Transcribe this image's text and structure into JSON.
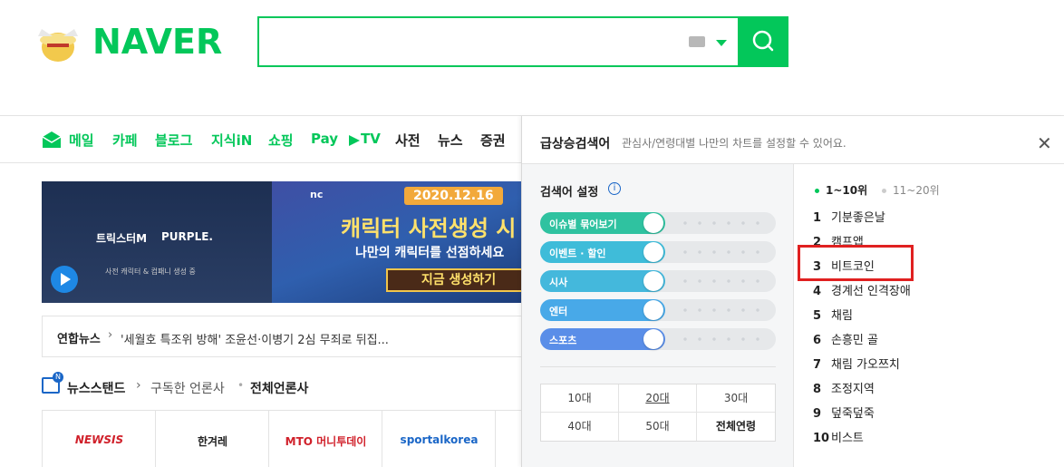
{
  "brand": {
    "logo_text": "NAVER",
    "accent": "#03c75a"
  },
  "search": {
    "value": "",
    "placeholder": ""
  },
  "nav": {
    "items": [
      {
        "label": "메일",
        "color": "green"
      },
      {
        "label": "카페",
        "color": "green"
      },
      {
        "label": "블로그",
        "color": "green"
      },
      {
        "label": "지식iN",
        "color": "green"
      },
      {
        "label": "쇼핑",
        "color": "green"
      },
      {
        "label": "Pay",
        "color": "green"
      },
      {
        "label": "TV",
        "color": "green"
      },
      {
        "label": "사전",
        "color": "dark"
      },
      {
        "label": "뉴스",
        "color": "dark"
      },
      {
        "label": "증권",
        "color": "dark"
      }
    ]
  },
  "banner": {
    "date": "2020.12.16",
    "title": "캐릭터 사전생성 시",
    "subtitle": "나만의 캐릭터를 선점하세요",
    "cta": "지금 생성하기",
    "maker": "nc",
    "game": "트릭스터M",
    "game2": "PURPLE.",
    "small": "사전 캐릭터 & 컴패니 생성 중"
  },
  "headline": {
    "source": "연합뉴스",
    "text": "'세월호 특조위 방해' 조윤선·이병기 2심 무죄로 뒤집..."
  },
  "newsstand": {
    "label": "뉴스스탠드",
    "subscribed": "구독한 언론사",
    "all": "전체언론사",
    "badge": "N"
  },
  "press": [
    "NEWSIS",
    "한겨레",
    "MTO 머니투데이",
    "sportalkorea"
  ],
  "panel": {
    "title": "급상승검색어",
    "description": "관심사/연령대별 나만의 차트를 설정할 수 있어요.",
    "settings_title": "검색어 설정",
    "toggles": [
      {
        "label": "이슈별 묶어보기",
        "color": "#2fc2a0"
      },
      {
        "label": "이벤트 · 할인",
        "color": "#3fbcd9"
      },
      {
        "label": "시사",
        "color": "#44b8dc"
      },
      {
        "label": "엔터",
        "color": "#48a9e8"
      },
      {
        "label": "스포츠",
        "color": "#5a8ee8"
      }
    ],
    "ages": [
      "10대",
      "20대",
      "30대",
      "40대",
      "50대",
      "전체연령"
    ],
    "tabs": [
      "1~10위",
      "11~20위"
    ],
    "ranks": [
      {
        "num": "1",
        "keyword": "기분좋은날"
      },
      {
        "num": "2",
        "keyword": "캠프앱"
      },
      {
        "num": "3",
        "keyword": "비트코인"
      },
      {
        "num": "4",
        "keyword": "경계선 인격장애"
      },
      {
        "num": "5",
        "keyword": "채림"
      },
      {
        "num": "6",
        "keyword": "손흥민 골"
      },
      {
        "num": "7",
        "keyword": "채림 가오쯔치"
      },
      {
        "num": "8",
        "keyword": "조정지역"
      },
      {
        "num": "9",
        "keyword": "덮죽덮죽"
      },
      {
        "num": "10",
        "keyword": "비스트"
      }
    ]
  }
}
